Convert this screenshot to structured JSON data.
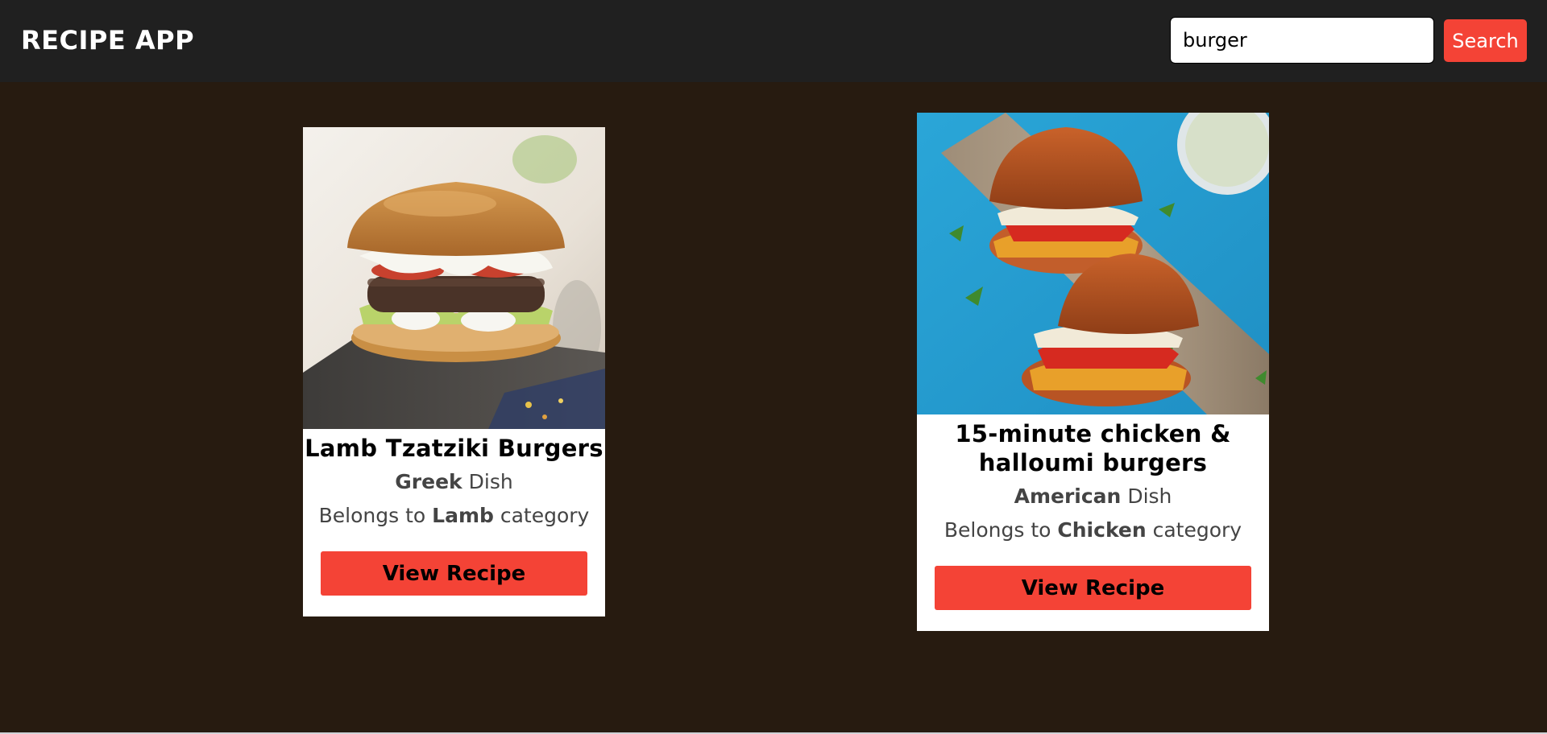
{
  "header": {
    "title": "RECIPE APP",
    "search_value": "burger",
    "search_button_label": "Search"
  },
  "recipes": [
    {
      "title": "Lamb Tzatziki Burgers",
      "cuisine": "Greek",
      "dish_suffix": "Dish",
      "category_prefix": "Belongs to",
      "category": "Lamb",
      "category_suffix": "category",
      "button_label": "View Recipe"
    },
    {
      "title": "15-minute chicken & halloumi burgers",
      "cuisine": "American",
      "dish_suffix": "Dish",
      "category_prefix": "Belongs to",
      "category": "Chicken",
      "category_suffix": "category",
      "button_label": "View Recipe"
    }
  ],
  "colors": {
    "header_bg": "#202020",
    "page_bg": "#271b10",
    "accent": "#f44336"
  },
  "icons": [
    "burger-photo",
    "chicken-halloumi-burgers-photo"
  ]
}
